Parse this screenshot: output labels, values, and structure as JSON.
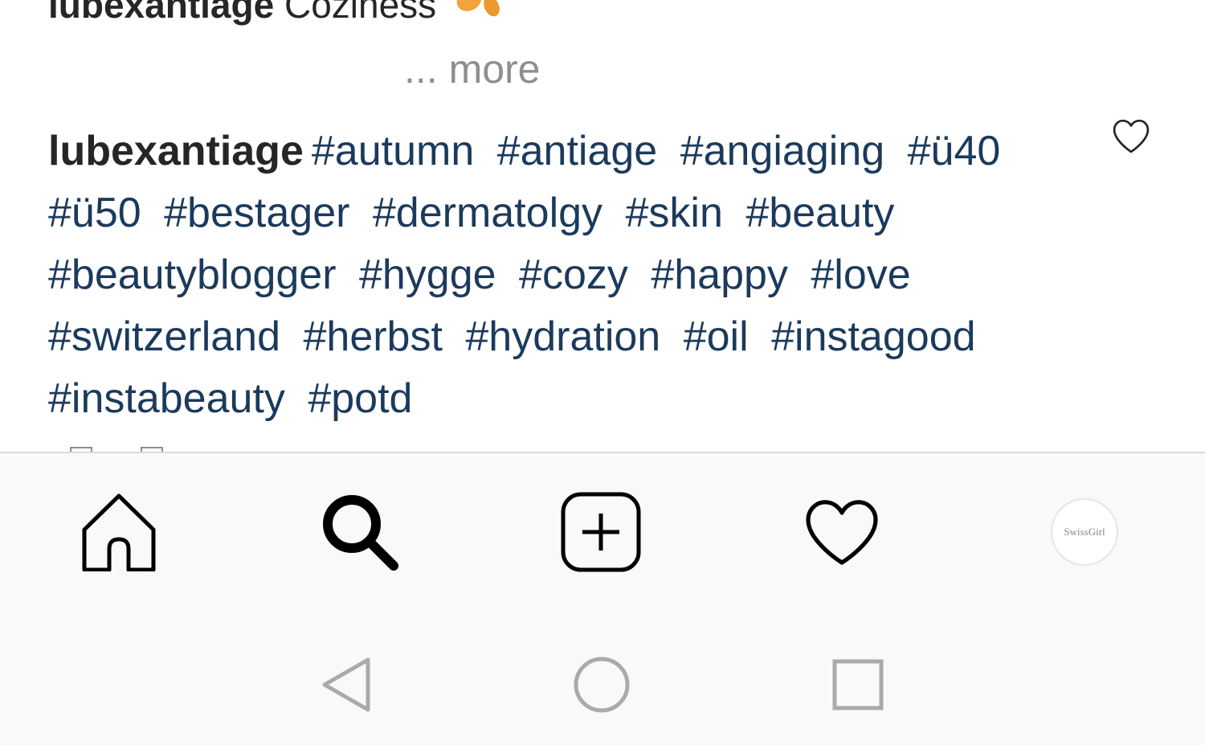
{
  "post": {
    "caption_user": "lubexantiage",
    "caption_text": "Coziness",
    "more_label": "... more"
  },
  "comment": {
    "user": "lubexantiage",
    "hashtags": [
      "#autumn",
      "#antiage",
      "#angiaging",
      "#ü40",
      "#ü50",
      "#bestager",
      "#dermatolgy",
      "#skin",
      "#beauty",
      "#beautyblogger",
      "#hygge",
      "#cozy",
      "#happy",
      "#love",
      "#switzerland",
      "#herbst",
      "#hydration",
      "#oil",
      "#instagood",
      "#instabeauty",
      "#potd"
    ]
  },
  "tabbar": {
    "items": [
      {
        "icon": "home-icon"
      },
      {
        "icon": "search-icon"
      },
      {
        "icon": "new-post-icon"
      },
      {
        "icon": "heart-icon"
      },
      {
        "icon": "profile-avatar"
      }
    ],
    "avatar_text": "SwissGirl"
  },
  "navbar": {
    "items": [
      {
        "icon": "back-triangle-icon"
      },
      {
        "icon": "home-circle-icon"
      },
      {
        "icon": "recents-square-icon"
      }
    ]
  },
  "colors": {
    "text": "#262626",
    "hashtag": "#1b3a5c",
    "muted": "#8e8e8e",
    "leaf_emoji": "#f2a33a",
    "bar_background": "#f9f9f9"
  }
}
